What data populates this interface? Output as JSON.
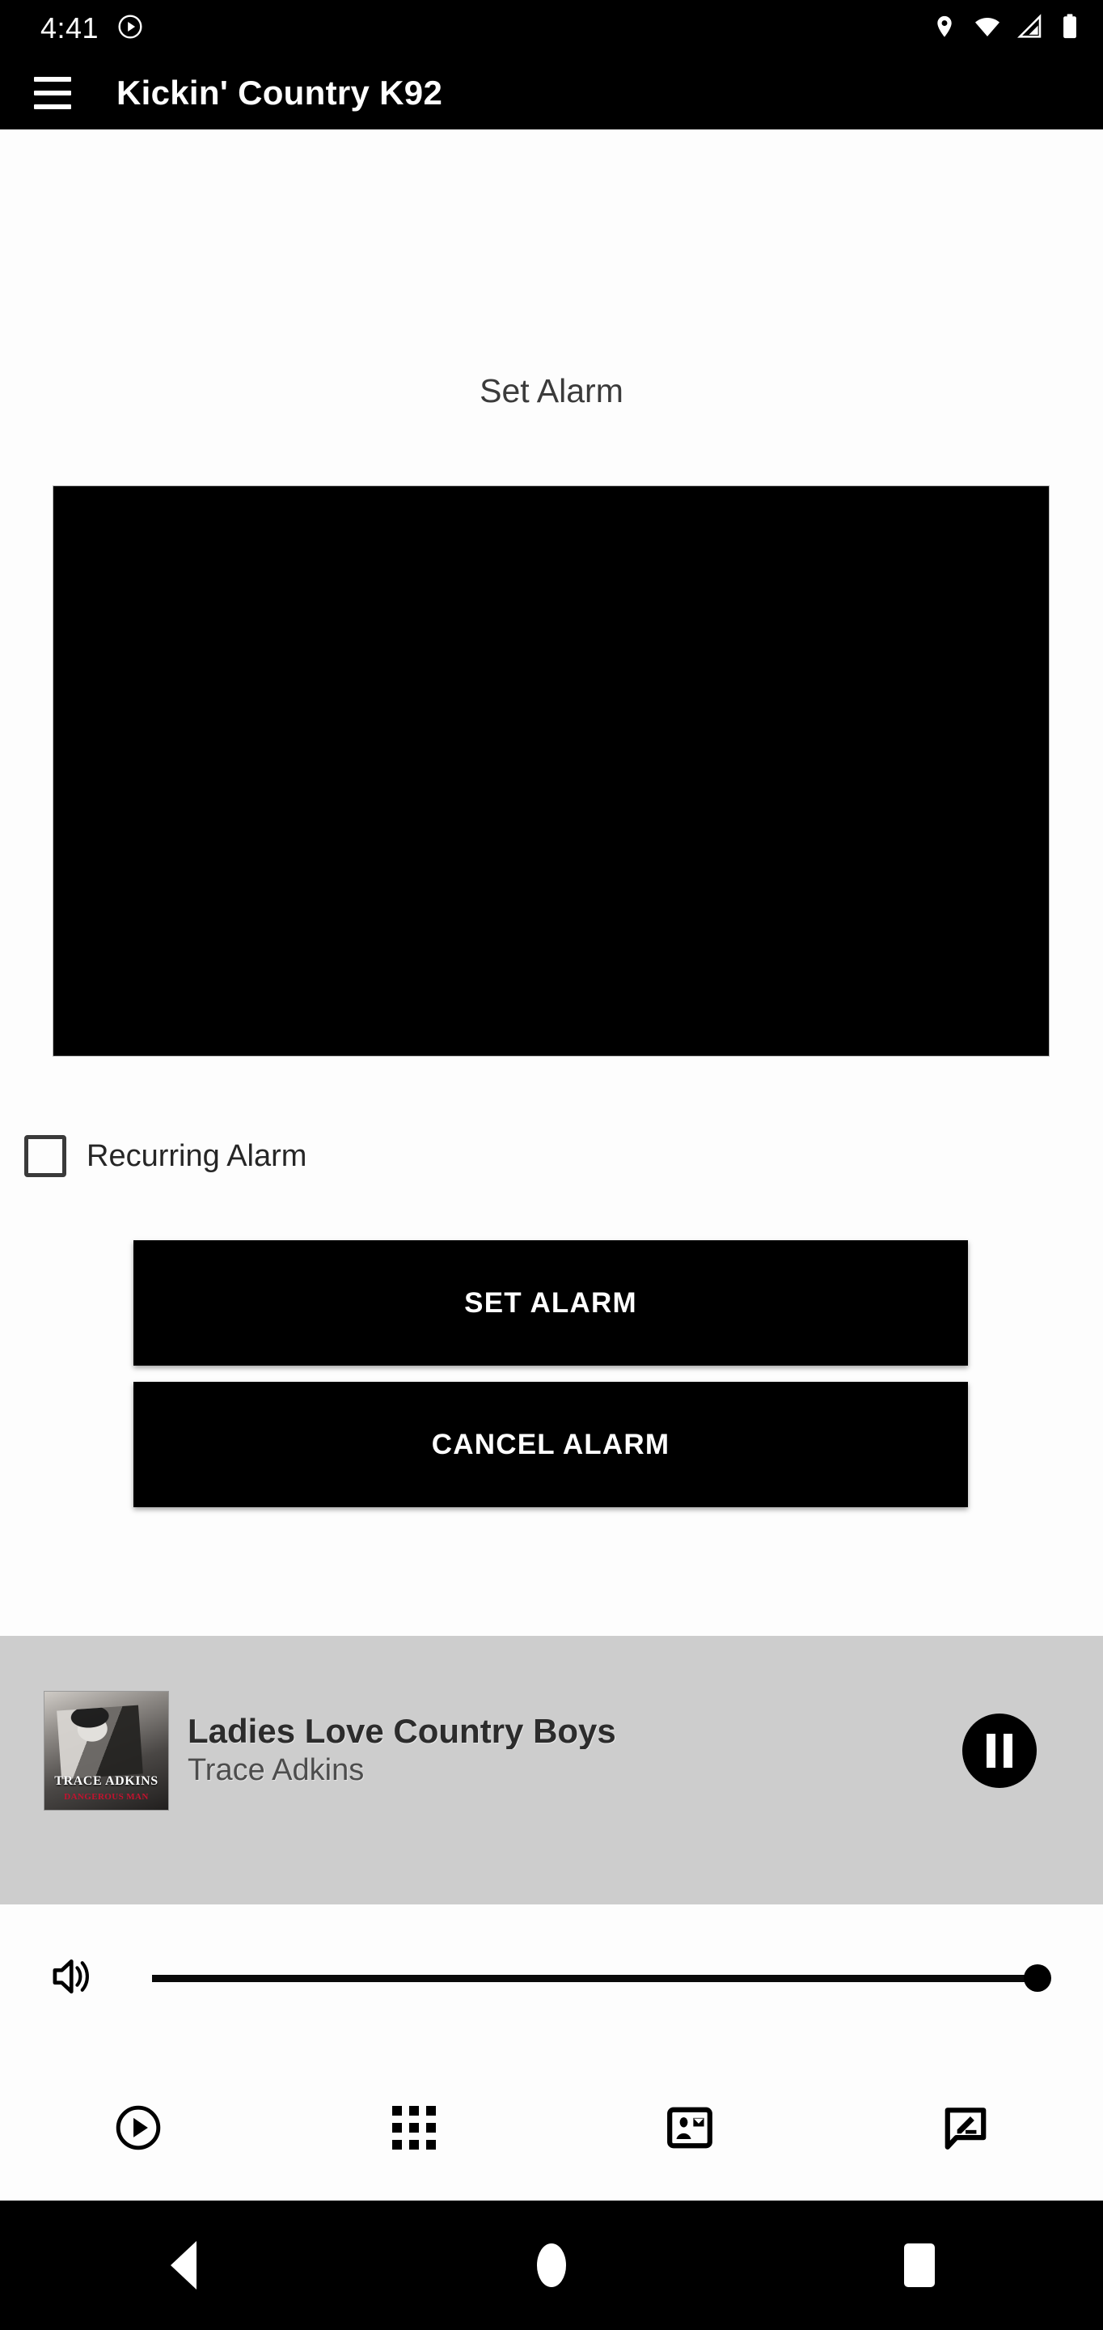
{
  "status_bar": {
    "clock": "4:41",
    "left_icons": [
      "play-circle-icon"
    ],
    "right_icons": [
      "location-pin-icon",
      "wifi-icon",
      "cellular-signal-icon",
      "battery-icon"
    ]
  },
  "app_bar": {
    "menu_icon": "hamburger-menu-icon",
    "title": "Kickin' Country K92"
  },
  "main": {
    "heading": "Set Alarm",
    "time_picker": {
      "name": "time-picker",
      "state": "blank",
      "background_color": "#000000"
    },
    "recurring": {
      "label": "Recurring Alarm",
      "checked": false
    },
    "buttons": {
      "set_alarm": "SET ALARM",
      "cancel_alarm": "CANCEL ALARM"
    },
    "drag_handle": "drag-handle"
  },
  "now_playing": {
    "song": "Ladies Love Country Boys",
    "artist": "Trace Adkins",
    "album_art": {
      "title": "TRACE ADKINS",
      "subtitle": "DANGEROUS MAN"
    },
    "playback_state": "playing",
    "control_icon": "pause-icon",
    "panel_color": "#cdcdcd"
  },
  "volume": {
    "icon": "speaker-volume-icon",
    "level": 100
  },
  "bottom_nav": [
    {
      "name": "nav-play",
      "icon": "play-circle-icon"
    },
    {
      "name": "nav-grid",
      "icon": "grid-apps-icon"
    },
    {
      "name": "nav-contact",
      "icon": "contact-card-icon"
    },
    {
      "name": "nav-feedback",
      "icon": "chat-compose-icon"
    }
  ],
  "android_nav": [
    {
      "name": "android-back-button",
      "icon": "back-triangle-icon"
    },
    {
      "name": "android-home-button",
      "icon": "home-circle-icon"
    },
    {
      "name": "android-recents-button",
      "icon": "recents-square-icon"
    }
  ],
  "colors": {
    "bar_background": "#000000",
    "content_background": "#fdfdfd",
    "button_background": "#000000",
    "button_text": "#ffffff",
    "accent_red": "#c4122f"
  }
}
